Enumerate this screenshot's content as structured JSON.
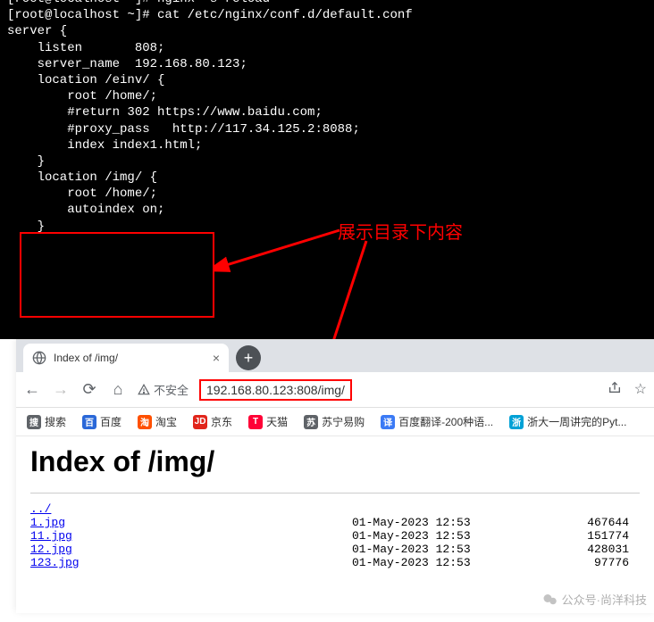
{
  "terminal": {
    "line0": "[root@localhost ~]# nginx -s reload",
    "line1": "[root@localhost ~]# cat /etc/nginx/conf.d/default.conf",
    "line2": "",
    "line3": "server {",
    "line4": "    listen       808;",
    "line5": "    server_name  192.168.80.123;",
    "line6": "",
    "line7": "    location /einv/ {",
    "line8": "        root /home/;",
    "line9": "        #return 302 https://www.baidu.com;",
    "line10": "        #proxy_pass   http://117.34.125.2:8088;",
    "line11": "        index index1.html;",
    "line12": "    }",
    "line13": "",
    "line14": "",
    "line15": "    location /img/ {",
    "line16": "        root /home/;",
    "line17": "        autoindex on;",
    "line18": "    }"
  },
  "annotation": {
    "text": "展示目录下内容"
  },
  "browser": {
    "tab": {
      "title": "Index of /img/"
    },
    "security": {
      "label": "不安全"
    },
    "url": "192.168.80.123:808/img/",
    "bookmarks": [
      {
        "label": "搜索",
        "bg": "#5f6368"
      },
      {
        "label": "百度",
        "bg": "#2a68d8"
      },
      {
        "label": "淘宝",
        "bg": "#ff5000"
      },
      {
        "label": "京东",
        "bg": "#e1251b"
      },
      {
        "label": "天猫",
        "bg": "#ff0036"
      },
      {
        "label": "苏宁易购",
        "bg": "#5f6368"
      },
      {
        "label": "百度翻译-200种语...",
        "bg": "#3b7af5"
      },
      {
        "label": "浙大一周讲完的Pyt...",
        "bg": "#00a1d6"
      }
    ],
    "page": {
      "heading": "Index of /img/",
      "parent": "../",
      "files": [
        {
          "name": "1.jpg",
          "date": "01-May-2023 12:53",
          "size": "467644"
        },
        {
          "name": "11.jpg",
          "date": "01-May-2023 12:53",
          "size": "151774"
        },
        {
          "name": "12.jpg",
          "date": "01-May-2023 12:53",
          "size": "428031"
        },
        {
          "name": "123.jpg",
          "date": "01-May-2023 12:53",
          "size": "97776"
        }
      ]
    }
  },
  "watermark": {
    "text": "公众号·尚洋科技"
  }
}
